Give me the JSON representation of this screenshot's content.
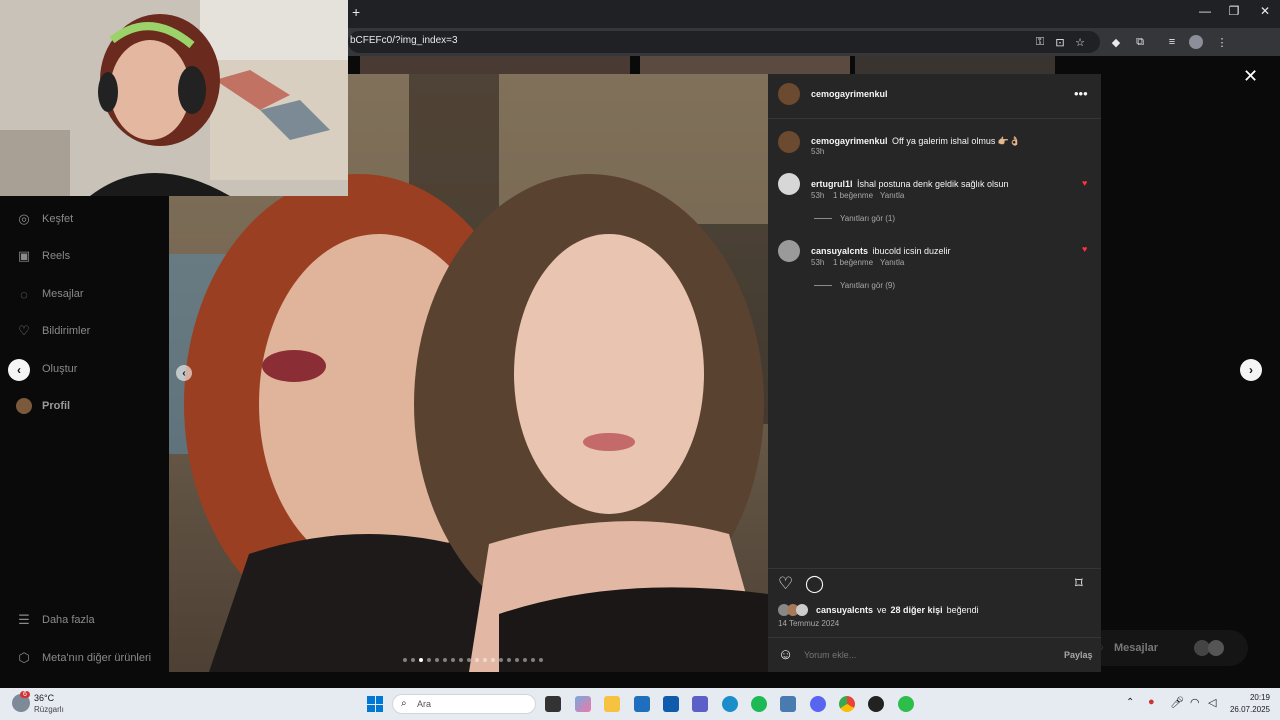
{
  "browser": {
    "new_tab": "+",
    "url": "bCFEFc0/?img_index=3",
    "window_controls": [
      "—",
      "❐",
      "✕"
    ]
  },
  "sidebar": {
    "items": [
      {
        "label": "Keşfet",
        "icon": "compass-icon"
      },
      {
        "label": "Reels",
        "icon": "reels-icon"
      },
      {
        "label": "Mesajlar",
        "icon": "messenger-icon"
      },
      {
        "label": "Bildirimler",
        "icon": "heart-icon"
      },
      {
        "label": "Oluştur",
        "icon": "plus-square-icon"
      },
      {
        "label": "Profil",
        "icon": "profile-avatar"
      }
    ],
    "more": "Daha fazla",
    "meta": "Meta'nın diğer ürünleri"
  },
  "messages_pill": "Mesajlar",
  "post": {
    "username": "cemogayrimenkul",
    "caption": {
      "user": "cemogayrimenkul",
      "text": "Off ya galerim ishal olmus 👉🏼👌🏼",
      "time": "53h"
    },
    "comments": [
      {
        "user": "ertugrul1l",
        "text": "İshal postuna denk geldik sağlık olsun",
        "time": "53h",
        "likes": "1 beğenme",
        "reply": "Yanıtla",
        "view_replies": "Yanıtları gör (1)"
      },
      {
        "user": "cansuyalcnts",
        "text": "ibucold icsin duzelir",
        "time": "53h",
        "likes": "1 beğenme",
        "reply": "Yanıtla",
        "view_replies": "Yanıtları gör (9)"
      }
    ],
    "likes_user": "cansuyalcnts",
    "likes_rest": "ve",
    "likes_others": "28 diğer kişi",
    "likes_suffix": "beğendi",
    "date": "14 Temmuz 2024",
    "comment_placeholder": "Yorum ekle...",
    "share_label": "Paylaş",
    "carousel_count": 18,
    "carousel_active": 3
  },
  "taskbar": {
    "weather_temp": "36°C",
    "weather_label": "Rüzgarlı",
    "weather_badge": "6",
    "search": "Ara",
    "time": "20:19",
    "date": "26.07.2025",
    "colors": {
      "accent": "#0067c0"
    }
  }
}
